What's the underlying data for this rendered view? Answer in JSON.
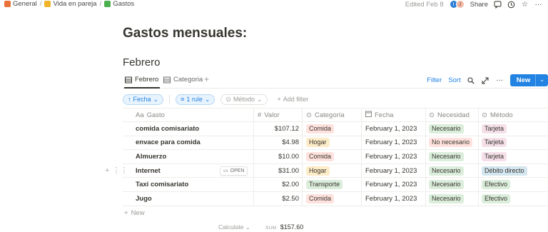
{
  "breadcrumb": [
    {
      "label": "General",
      "icon": "home-icon",
      "color": "#e8743b"
    },
    {
      "label": "Vida en pareja",
      "icon": "couple-icon",
      "color": "#f0b429"
    },
    {
      "label": "Gastos",
      "icon": "money-icon",
      "color": "#4caf50"
    }
  ],
  "topbar": {
    "edited": "Edited Feb 8",
    "share": "Share",
    "avatar1": "I",
    "avatar2": "J"
  },
  "page": {
    "title": "Gastos mensuales:",
    "section": "Febrero"
  },
  "views": {
    "tab1": "Febrero",
    "tab2": "Categoria",
    "add": "+"
  },
  "actions": {
    "filter": "Filter",
    "sort": "Sort",
    "new": "New"
  },
  "filters": {
    "fecha": "Fecha",
    "rule": "1 rule",
    "metodo": "Método",
    "add": "Add filter"
  },
  "columns": {
    "gasto": "Gasto",
    "gasto_prefix": "Aa",
    "valor": "Valor",
    "categoria": "Categoría",
    "fecha": "Fecha",
    "necesidad": "Necesidad",
    "metodo": "Método"
  },
  "open_label": "OPEN",
  "rows": [
    {
      "gasto": "comida comisariato",
      "valor": "$107.12",
      "categoria": "Comida",
      "fecha": "February 1, 2023",
      "necesidad": "Necesario",
      "metodo": "Tarjeta"
    },
    {
      "gasto": "envace para comida",
      "valor": "$4.98",
      "categoria": "Hogar",
      "fecha": "February 1, 2023",
      "necesidad": "No necesario",
      "metodo": "Tarjeta"
    },
    {
      "gasto": "Almuerzo",
      "valor": "$10.00",
      "categoria": "Comida",
      "fecha": "February 1, 2023",
      "necesidad": "Necesario",
      "metodo": "Tarjeta"
    },
    {
      "gasto": "Internet",
      "valor": "$31.00",
      "categoria": "Hogar",
      "fecha": "February 1, 2023",
      "necesidad": "Necesario",
      "metodo": "Débito directo"
    },
    {
      "gasto": "Taxi comisariato",
      "valor": "$2.00",
      "categoria": "Transporte",
      "fecha": "February 1, 2023",
      "necesidad": "Necesario",
      "metodo": "Efectivo"
    },
    {
      "gasto": "Jugo",
      "valor": "$2.50",
      "categoria": "Comida",
      "fecha": "February 1, 2023",
      "necesidad": "Necesario",
      "metodo": "Efectivo"
    }
  ],
  "tag_colors": {
    "Comida": "#ffe2dd",
    "Hogar": "#fdecc8",
    "Transporte": "#dbeddb",
    "Necesario": "#dbeddb",
    "No necesario": "#ffe2dd",
    "Tarjeta": "#f5e0e9",
    "Débito directo": "#d3e5ef",
    "Efectivo": "#dbeddb"
  },
  "new_row": "New",
  "footer": {
    "calculate": "Calculate",
    "sum_label": "SUM",
    "sum_value": "$157.60"
  }
}
